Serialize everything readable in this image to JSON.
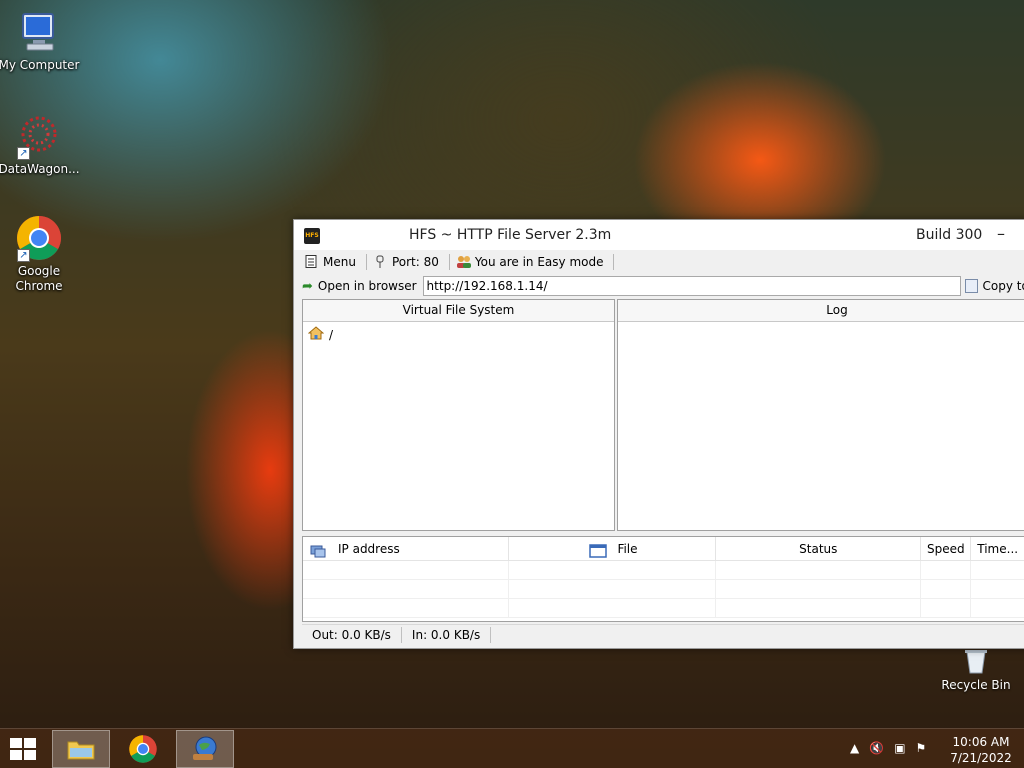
{
  "desktop": {
    "icons": [
      {
        "label": "My Computer"
      },
      {
        "label": "DataWagon..."
      },
      {
        "label": "Google\nChrome"
      }
    ],
    "recycle_bin": "Recycle Bin"
  },
  "window": {
    "title": "HFS ~ HTTP File Server 2.3m",
    "build": "Build 300",
    "toolbar": {
      "menu": "Menu",
      "port": "Port: 80",
      "mode": "You are in Easy mode"
    },
    "url_bar": {
      "open_label": "Open in browser",
      "url": "http://192.168.1.14/",
      "copy_label": "Copy to"
    },
    "vfs": {
      "header": "Virtual File System",
      "root": "/"
    },
    "log": {
      "header": "Log"
    },
    "connections": {
      "columns": [
        "IP address",
        "File",
        "Status",
        "Speed",
        "Time..."
      ]
    },
    "status": {
      "out": "Out: 0.0 KB/s",
      "in": "In: 0.0 KB/s"
    }
  },
  "taskbar": {
    "time": "10:06 AM",
    "date": "7/21/2022"
  },
  "colors": {
    "window_bg": "#f0f0f0",
    "taskbar_bg": "#46281499"
  }
}
